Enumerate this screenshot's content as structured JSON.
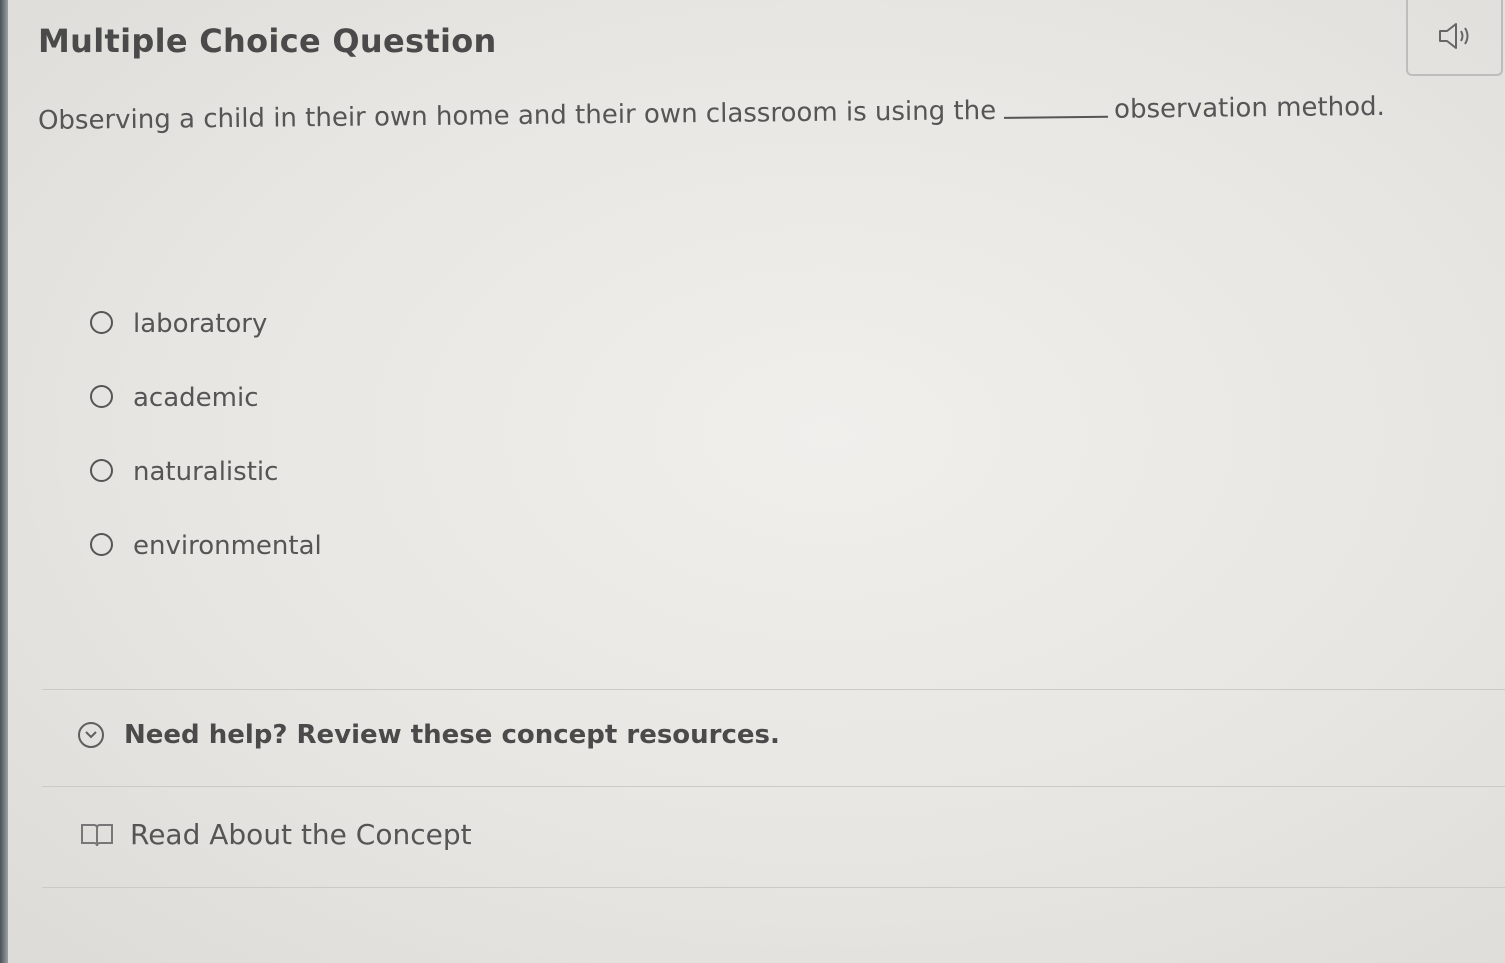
{
  "header": {
    "title": "Multiple Choice Question",
    "speaker_icon": "speaker-volume-icon"
  },
  "question": {
    "text_before": "Observing a child in their own home and their own classroom is using the",
    "text_after": "observation method."
  },
  "options": [
    {
      "label": "laboratory",
      "selected": false
    },
    {
      "label": "academic",
      "selected": false
    },
    {
      "label": "naturalistic",
      "selected": false
    },
    {
      "label": "environmental",
      "selected": false
    }
  ],
  "help": {
    "label": "Need help? Review these concept resources.",
    "icon": "chevron-down-circle-icon"
  },
  "resources": [
    {
      "label": "Read About the Concept",
      "icon": "book-icon"
    }
  ],
  "colors": {
    "background": "#ebe9e6",
    "text": "#555555",
    "title": "#4a4a4a",
    "divider": "#cbcac6"
  }
}
